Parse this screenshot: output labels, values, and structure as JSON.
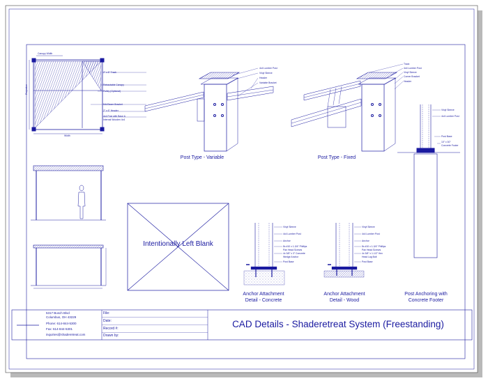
{
  "colors": {
    "ink": "#1a1aa0",
    "light": "#7a7ae0",
    "paper": "#ffffff",
    "shadow": "#b9b9b9"
  },
  "captions": {
    "post_variable": "Post Type - Variable",
    "post_fixed": "Post Type - Fixed",
    "blank": "Intentionally Left Blank",
    "anchor_concrete": [
      "Anchor Attachment",
      "Detail - Concrete"
    ],
    "anchor_wood": [
      "Anchor Attachment",
      "Detail - Wood"
    ],
    "post_footer": [
      "Post Anchoring with",
      "Concrete Footer"
    ]
  },
  "plan_labels": [
    "Canopy Width",
    "2\" x 6\" Track",
    "Retractable Canopy",
    "Pulley (Optional)",
    "Mid Beam Bracket",
    "2\" x 6\" Header",
    "4x4 Post with Base &",
    "Internal Wooden 4x4",
    "Projection",
    "Width"
  ],
  "variable_labels": [
    "4x4 Lumber Post",
    "Vinyl Sleeve",
    "Header",
    "Variable Bracket"
  ],
  "fixed_labels": [
    "Track",
    "4x4 Lumber Post",
    "Vinyl Sleeve",
    "Corner Bracket",
    "Header"
  ],
  "footer_labels": [
    "Vinyl Sleeve",
    "4x4 Lumber Post",
    "Post Base",
    "10\" x 30\"",
    "Concrete Footer"
  ],
  "concrete_labels": [
    "Vinyl Sleeve",
    "4x4 Lumber Post",
    "Anchor",
    "8x #10 x 1-3/4\" Phillips",
    "Pan Head Screws",
    "4x 3/8\" x 3\" Concrete",
    "Wedge Anchor",
    "Post Base"
  ],
  "wood_labels": [
    "Vinyl Sleeve",
    "4x4 Lumber Post",
    "Anchor",
    "8x #10 x 1-3/4\" Phillips",
    "Pan Head Screws",
    "4x 3/8\" x 1-1/2\" Hex",
    "Head Lag Bolt",
    "Post Base"
  ],
  "title_block": {
    "address": [
      "5317 Busch Blvd",
      "Columbus, OH 43229"
    ],
    "phone": "Phone: 614-844-5300",
    "fax": "Fax: 614-844-5301",
    "email": "inquiries@shaderetreat.com",
    "fields": [
      "File:",
      "Date:",
      "Record #:",
      "Drawn by:"
    ],
    "title": "CAD Details - Shaderetreat System (Freestanding)"
  }
}
